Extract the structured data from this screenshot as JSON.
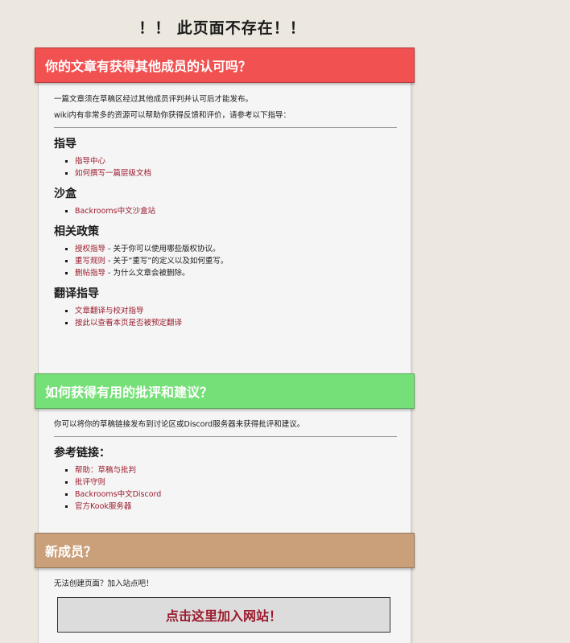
{
  "page": {
    "title": "！！ 此页面不存在！！"
  },
  "section1": {
    "banner": "你的文章有获得其他成员的认可吗？",
    "intro1": "一篇文章须在草稿区经过其他成员评判并认可后才能发布。",
    "intro2": "wiki内有非常多的资源可以帮助你获得反馈和评价，请参考以下指导：",
    "guides": {
      "heading": "指导",
      "items": [
        "指导中心",
        "如何撰写一篇层级文档"
      ]
    },
    "sandbox": {
      "heading": "沙盒",
      "items": [
        "Backrooms中文沙盒站"
      ]
    },
    "policy": {
      "heading": "相关政策",
      "items": [
        {
          "link": "授权指导",
          "desc": " - 关于你可以使用哪些版权协议。"
        },
        {
          "link": "重写规则",
          "desc": " - 关于“重写”的定义以及如何重写。"
        },
        {
          "link": "删帖指导",
          "desc": " - 为什么文章会被删除。"
        }
      ]
    },
    "translation": {
      "heading": "翻译指导",
      "items": [
        "文章翻译与校对指导",
        "按此以查看本页是否被预定翻译"
      ]
    }
  },
  "section2": {
    "banner": "如何获得有用的批评和建议？",
    "intro": "你可以将你的草稿链接发布到讨论区或Discord服务器来获得批评和建议。",
    "links": {
      "heading": "参考链接：",
      "items": [
        "帮助：草稿与批判",
        "批评守则",
        "Backrooms中文Discord",
        "官方Kook服务器"
      ]
    }
  },
  "section3": {
    "banner": "新成员？",
    "intro": "无法创建页面？加入站点吧！",
    "join_button": "点击这里加入网站！"
  },
  "colors": {
    "background": "#ede8df",
    "banner_red": "#f15151",
    "banner_green": "#76e078",
    "banner_tan": "#c9a07a",
    "link": "#9b1c2e"
  }
}
